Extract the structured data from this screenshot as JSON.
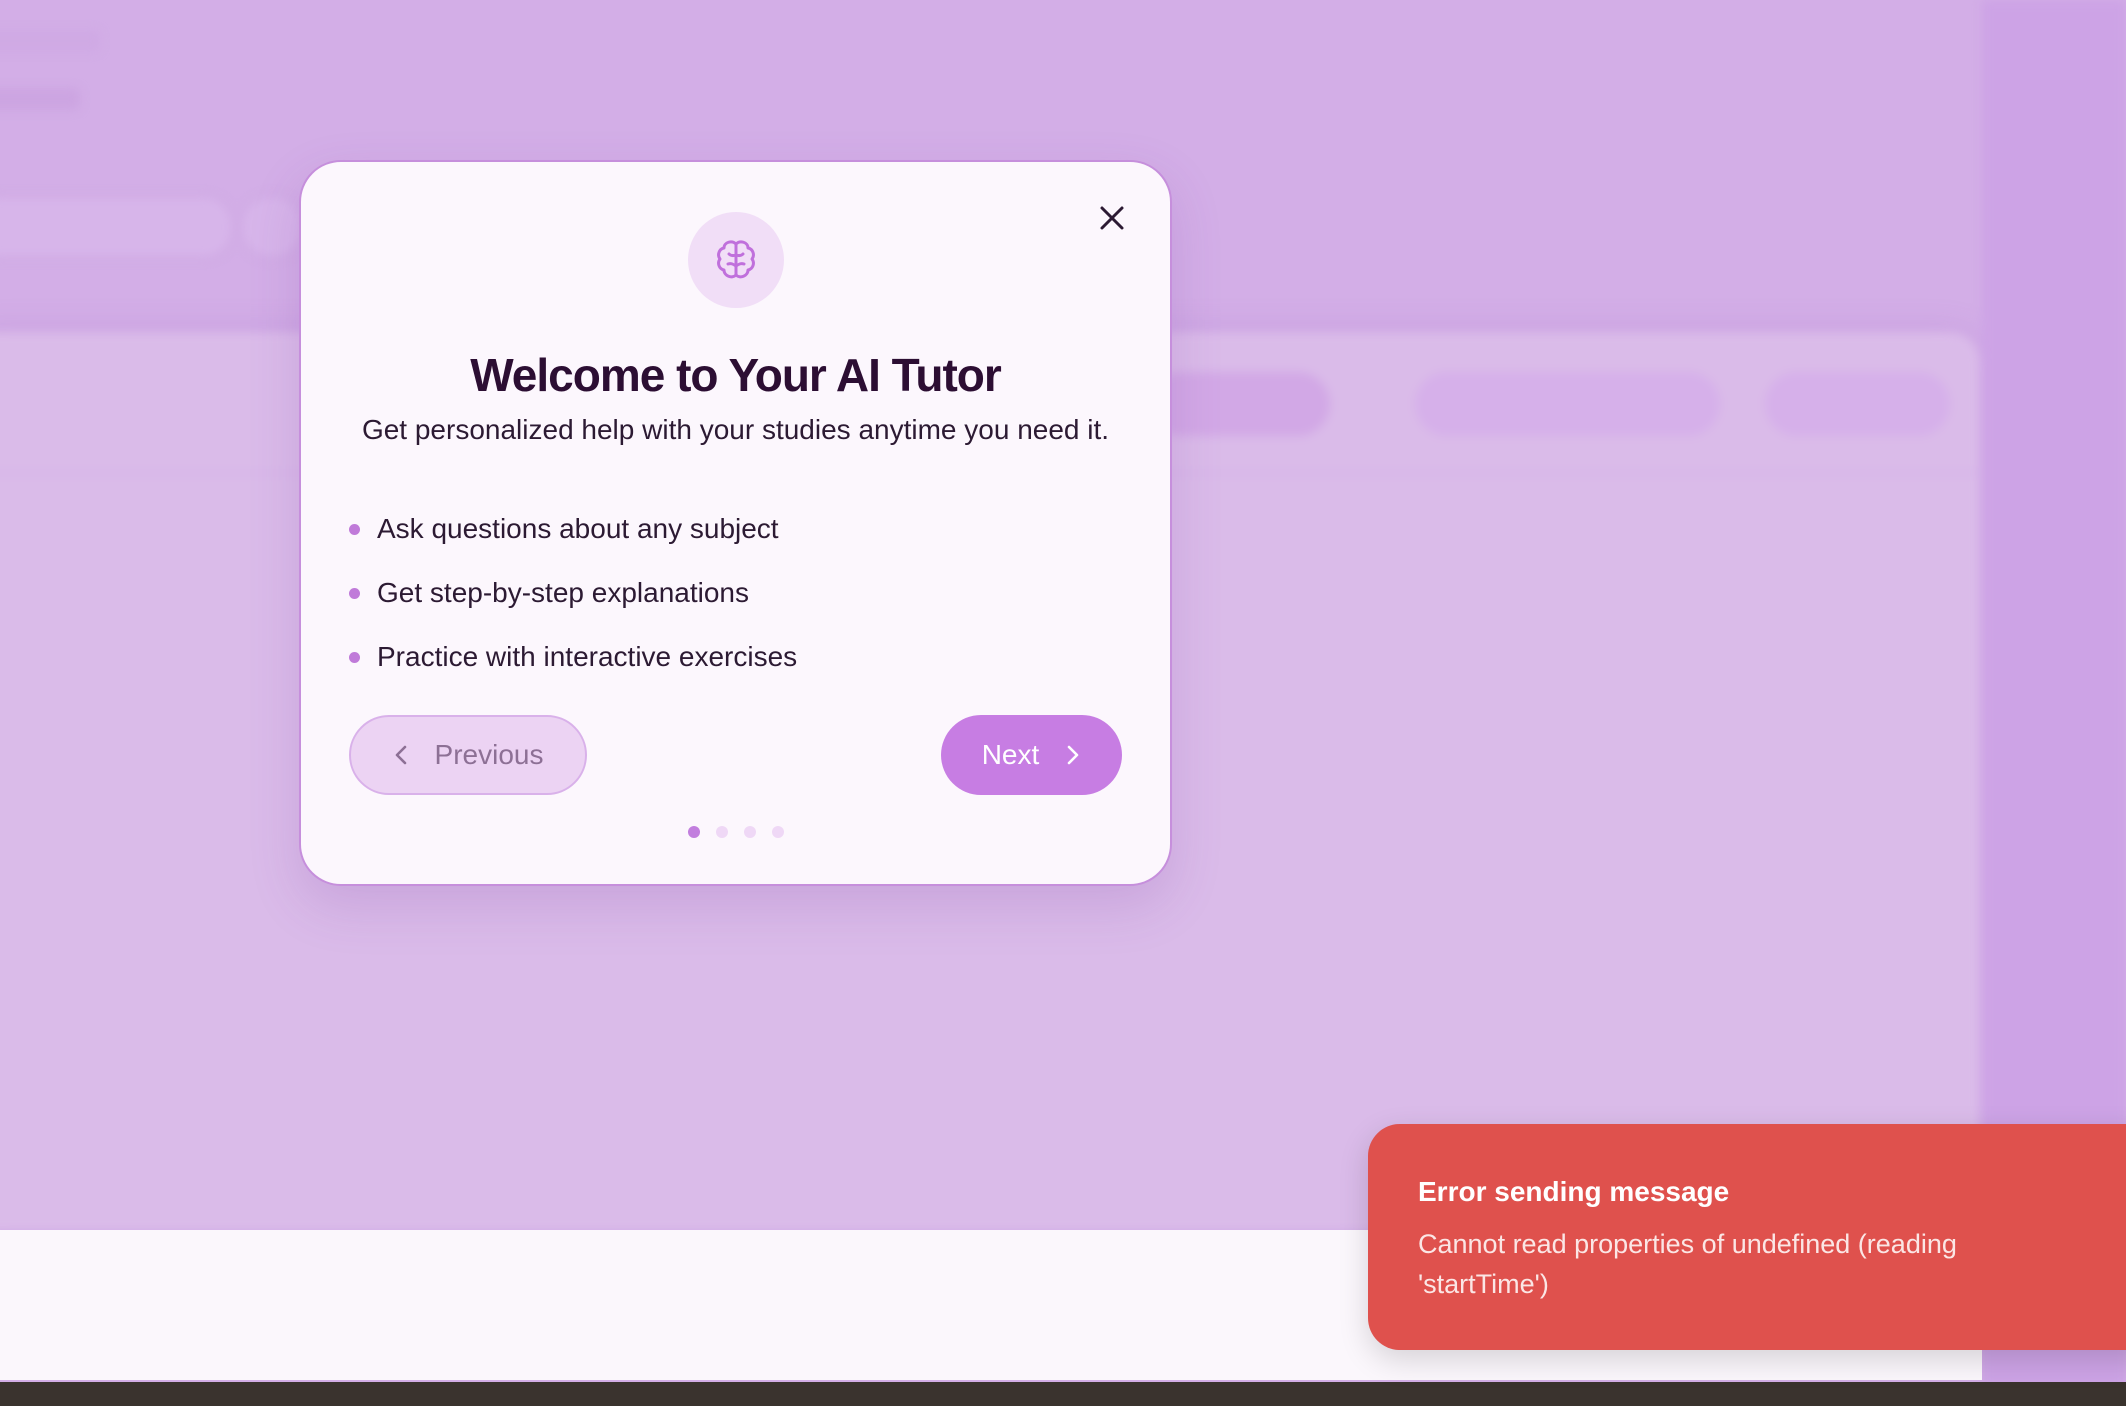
{
  "modal": {
    "title": "Welcome to Your AI Tutor",
    "subtitle": "Get personalized help with your studies anytime you need it.",
    "icon": "brain-icon",
    "features": [
      "Ask questions about any subject",
      "Get step-by-step explanations",
      "Practice with interactive exercises"
    ],
    "previous_label": "Previous",
    "next_label": "Next",
    "step_current": 1,
    "step_total": 4
  },
  "toast": {
    "title": "Error sending message",
    "message": "Cannot read properties of undefined (reading 'startTime')"
  },
  "colors": {
    "accent": "#c77de3",
    "background": "#d3aee7",
    "error": "#df514d"
  }
}
